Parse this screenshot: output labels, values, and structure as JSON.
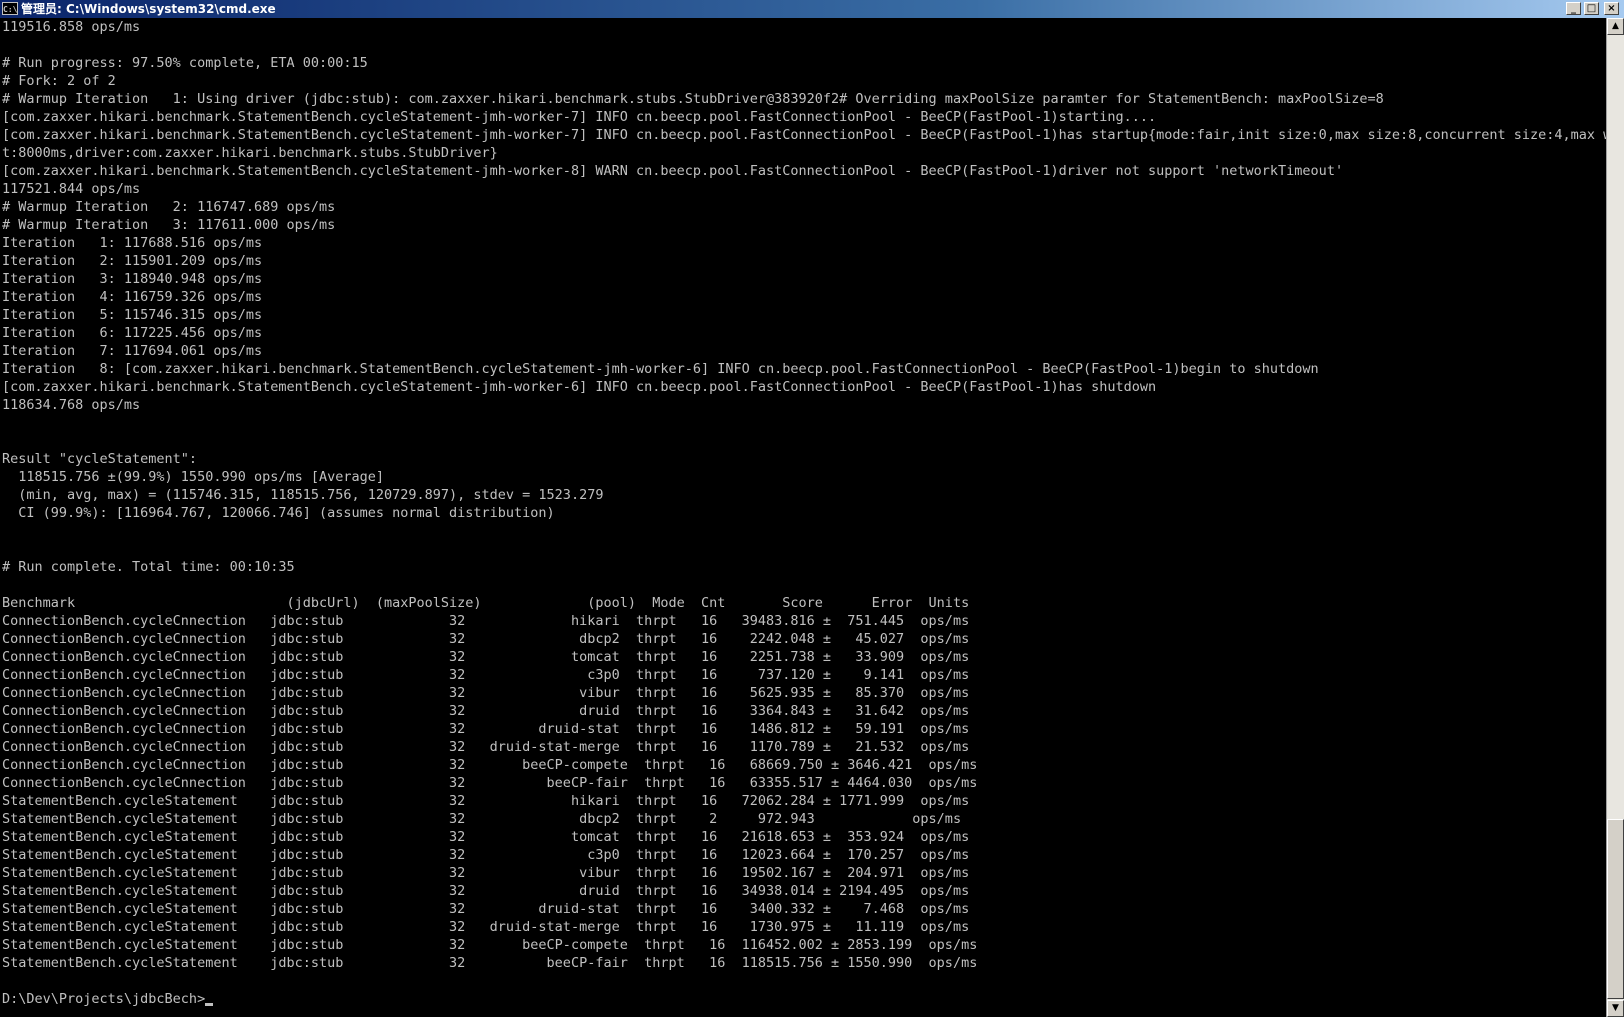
{
  "window": {
    "title": "管理员: C:\\Windows\\system32\\cmd.exe",
    "icon_label": "C:\\",
    "minimize_label": "_",
    "maximize_label": "□",
    "close_label": "×"
  },
  "console": {
    "lines": [
      "119516.858 ops/ms",
      "",
      "# Run progress: 97.50% complete, ETA 00:00:15",
      "# Fork: 2 of 2",
      "# Warmup Iteration   1: Using driver (jdbc:stub): com.zaxxer.hikari.benchmark.stubs.StubDriver@383920f2# Overriding maxPoolSize paramter for StatementBench: maxPoolSize=8",
      "[com.zaxxer.hikari.benchmark.StatementBench.cycleStatement-jmh-worker-7] INFO cn.beecp.pool.FastConnectionPool - BeeCP(FastPool-1)starting....",
      "[com.zaxxer.hikari.benchmark.StatementBench.cycleStatement-jmh-worker-7] INFO cn.beecp.pool.FastConnectionPool - BeeCP(FastPool-1)has startup{mode:fair,init size:0,max size:8,concurrent size:4,max wai",
      "t:8000ms,driver:com.zaxxer.hikari.benchmark.stubs.StubDriver}",
      "[com.zaxxer.hikari.benchmark.StatementBench.cycleStatement-jmh-worker-8] WARN cn.beecp.pool.FastConnectionPool - BeeCP(FastPool-1)driver not support 'networkTimeout'",
      "117521.844 ops/ms",
      "# Warmup Iteration   2: 116747.689 ops/ms",
      "# Warmup Iteration   3: 117611.000 ops/ms",
      "Iteration   1: 117688.516 ops/ms",
      "Iteration   2: 115901.209 ops/ms",
      "Iteration   3: 118940.948 ops/ms",
      "Iteration   4: 116759.326 ops/ms",
      "Iteration   5: 115746.315 ops/ms",
      "Iteration   6: 117225.456 ops/ms",
      "Iteration   7: 117694.061 ops/ms",
      "Iteration   8: [com.zaxxer.hikari.benchmark.StatementBench.cycleStatement-jmh-worker-6] INFO cn.beecp.pool.FastConnectionPool - BeeCP(FastPool-1)begin to shutdown",
      "[com.zaxxer.hikari.benchmark.StatementBench.cycleStatement-jmh-worker-6] INFO cn.beecp.pool.FastConnectionPool - BeeCP(FastPool-1)has shutdown",
      "118634.768 ops/ms",
      "",
      "",
      "Result \"cycleStatement\":",
      "  118515.756 ±(99.9%) 1550.990 ops/ms [Average]",
      "  (min, avg, max) = (115746.315, 118515.756, 120729.897), stdev = 1523.279",
      "  CI (99.9%): [116964.767, 120066.746] (assumes normal distribution)",
      "",
      "",
      "# Run complete. Total time: 00:10:35",
      "",
      "Benchmark                          (jdbcUrl)  (maxPoolSize)             (pool)  Mode  Cnt       Score      Error  Units",
      "ConnectionBench.cycleCnnection   jdbc:stub             32             hikari  thrpt   16   39483.816 ±  751.445  ops/ms",
      "ConnectionBench.cycleCnnection   jdbc:stub             32              dbcp2  thrpt   16    2242.048 ±   45.027  ops/ms",
      "ConnectionBench.cycleCnnection   jdbc:stub             32             tomcat  thrpt   16    2251.738 ±   33.909  ops/ms",
      "ConnectionBench.cycleCnnection   jdbc:stub             32               c3p0  thrpt   16     737.120 ±    9.141  ops/ms",
      "ConnectionBench.cycleCnnection   jdbc:stub             32              vibur  thrpt   16    5625.935 ±   85.370  ops/ms",
      "ConnectionBench.cycleCnnection   jdbc:stub             32              druid  thrpt   16    3364.843 ±   31.642  ops/ms",
      "ConnectionBench.cycleCnnection   jdbc:stub             32         druid-stat  thrpt   16    1486.812 ±   59.191  ops/ms",
      "ConnectionBench.cycleCnnection   jdbc:stub             32   druid-stat-merge  thrpt   16    1170.789 ±   21.532  ops/ms",
      "ConnectionBench.cycleCnnection   jdbc:stub             32       beeCP-compete  thrpt   16   68669.750 ± 3646.421  ops/ms",
      "ConnectionBench.cycleCnnection   jdbc:stub             32          beeCP-fair  thrpt   16   63355.517 ± 4464.030  ops/ms",
      "StatementBench.cycleStatement    jdbc:stub             32             hikari  thrpt   16   72062.284 ± 1771.999  ops/ms",
      "StatementBench.cycleStatement    jdbc:stub             32              dbcp2  thrpt    2     972.943            ops/ms",
      "StatementBench.cycleStatement    jdbc:stub             32             tomcat  thrpt   16   21618.653 ±  353.924  ops/ms",
      "StatementBench.cycleStatement    jdbc:stub             32               c3p0  thrpt   16   12023.664 ±  170.257  ops/ms",
      "StatementBench.cycleStatement    jdbc:stub             32              vibur  thrpt   16   19502.167 ±  204.971  ops/ms",
      "StatementBench.cycleStatement    jdbc:stub             32              druid  thrpt   16   34938.014 ± 2194.495  ops/ms",
      "StatementBench.cycleStatement    jdbc:stub             32         druid-stat  thrpt   16    3400.332 ±    7.468  ops/ms",
      "StatementBench.cycleStatement    jdbc:stub             32   druid-stat-merge  thrpt   16    1730.975 ±   11.119  ops/ms",
      "StatementBench.cycleStatement    jdbc:stub             32       beeCP-compete  thrpt   16  116452.002 ± 2853.199  ops/ms",
      "StatementBench.cycleStatement    jdbc:stub             32          beeCP-fair  thrpt   16  118515.756 ± 1550.990  ops/ms",
      ""
    ],
    "prompt": "D:\\Dev\\Projects\\jdbcBech>"
  },
  "scrollbar": {
    "up_arrow": "▲",
    "down_arrow": "▼"
  }
}
